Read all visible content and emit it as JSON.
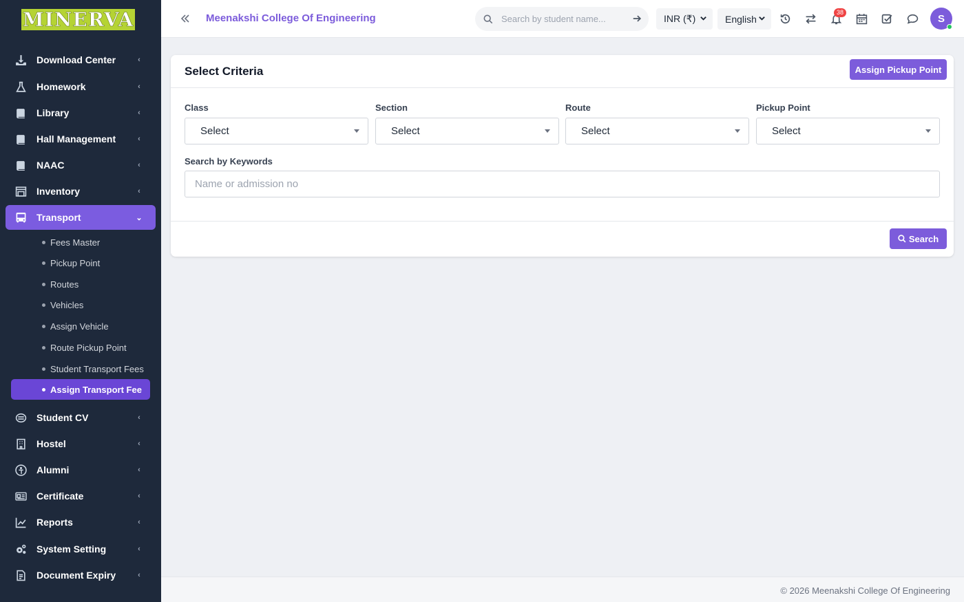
{
  "sidebar": {
    "logo": "MINERVA",
    "items": [
      {
        "label": "Download Center",
        "icon": "download-icon"
      },
      {
        "label": "Homework",
        "icon": "flask-icon"
      },
      {
        "label": "Library",
        "icon": "book-icon"
      },
      {
        "label": "Hall Management",
        "icon": "book-icon"
      },
      {
        "label": "NAAC",
        "icon": "book-icon"
      },
      {
        "label": "Inventory",
        "icon": "inventory-icon"
      },
      {
        "label": "Transport",
        "icon": "bus-icon"
      },
      {
        "label": "Student CV",
        "icon": "cv-icon"
      },
      {
        "label": "Hostel",
        "icon": "building-icon"
      },
      {
        "label": "Alumni",
        "icon": "alumni-icon"
      },
      {
        "label": "Certificate",
        "icon": "certificate-icon"
      },
      {
        "label": "Reports",
        "icon": "chart-line-icon"
      },
      {
        "label": "System Setting",
        "icon": "gears-icon"
      },
      {
        "label": "Document Expiry",
        "icon": "document-icon"
      }
    ],
    "transport_sub": [
      "Fees Master",
      "Pickup Point",
      "Routes",
      "Vehicles",
      "Assign Vehicle",
      "Route Pickup Point",
      "Student Transport Fees",
      "Assign Transport Fee"
    ],
    "active_item": "Transport",
    "active_sub": "Assign Transport Fee"
  },
  "header": {
    "title": "Meenakshi College Of Engineering",
    "search_placeholder": "Search by student name...",
    "currency": "INR (₹)",
    "language": "English",
    "notification_count": "38",
    "avatar_initial": "S"
  },
  "main": {
    "card_title": "Select Criteria",
    "assign_button": "Assign Pickup Point",
    "fields": [
      {
        "label": "Class",
        "value": "Select"
      },
      {
        "label": "Section",
        "value": "Select"
      },
      {
        "label": "Route",
        "value": "Select"
      },
      {
        "label": "Pickup Point",
        "value": "Select"
      }
    ],
    "keyword_label": "Search by Keywords",
    "keyword_placeholder": "Name or admission no",
    "search_button": "Search"
  },
  "footer": {
    "text": "© 2026 Meenakshi College Of Engineering"
  },
  "colors": {
    "accent": "#7c5cdb",
    "sidebar_bg": "#1e293b",
    "active_sub_bg": "#6a46d6",
    "logo_bg": "#b5d334",
    "badge": "#ef4444"
  }
}
